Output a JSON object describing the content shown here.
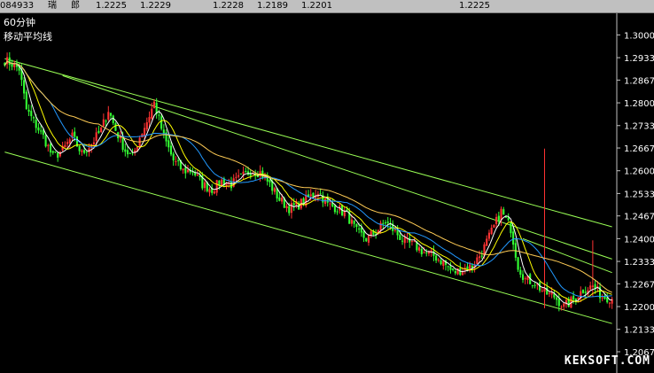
{
  "header": {
    "fields": [
      "084933",
      "瑞",
      "郎",
      "1.2225",
      "1.2229",
      "1.2228",
      "1.2189",
      "1.2201",
      "1.2225"
    ]
  },
  "main_title": "60分钟",
  "subtitle": "移动平均线",
  "watermark": "KEKSOFT.COM",
  "chart_data": {
    "type": "candlestick",
    "title": "60分钟",
    "subtitle": "移动平均线",
    "ylim": [
      1.2067,
      1.3035
    ],
    "y_ticks": [
      "1.3000",
      "1.2933",
      "1.2867",
      "1.2800",
      "1.2733",
      "1.2667",
      "1.2600",
      "1.2533",
      "1.2467",
      "1.2400",
      "1.2333",
      "1.2267",
      "1.2200",
      "1.2133",
      "1.2067"
    ],
    "grid": false,
    "candles_shown": 190,
    "close_path_anchors": [
      [
        0,
        1.2925
      ],
      [
        3,
        1.2915
      ],
      [
        6,
        1.29
      ],
      [
        9,
        1.278
      ],
      [
        12,
        1.2745
      ],
      [
        16,
        1.27
      ],
      [
        20,
        1.264
      ],
      [
        24,
        1.266
      ],
      [
        28,
        1.27
      ],
      [
        32,
        1.265
      ],
      [
        36,
        1.268
      ],
      [
        40,
        1.272
      ],
      [
        43,
        1.278
      ],
      [
        46,
        1.272
      ],
      [
        50,
        1.266
      ],
      [
        53,
        1.264
      ],
      [
        56,
        1.27
      ],
      [
        59,
        1.2745
      ],
      [
        62,
        1.28
      ],
      [
        66,
        1.27
      ],
      [
        70,
        1.263
      ],
      [
        74,
        1.26
      ],
      [
        78,
        1.26
      ],
      [
        82,
        1.256
      ],
      [
        86,
        1.2545
      ],
      [
        90,
        1.257
      ],
      [
        94,
        1.256
      ],
      [
        98,
        1.258
      ],
      [
        102,
        1.26
      ],
      [
        106,
        1.2595
      ],
      [
        110,
        1.256
      ],
      [
        114,
        1.2515
      ],
      [
        118,
        1.249
      ],
      [
        122,
        1.25
      ],
      [
        126,
        1.252
      ],
      [
        130,
        1.254
      ],
      [
        134,
        1.25
      ],
      [
        138,
        1.249
      ],
      [
        142,
        1.247
      ],
      [
        146,
        1.242
      ],
      [
        150,
        1.24
      ],
      [
        154,
        1.242
      ],
      [
        158,
        1.245
      ],
      [
        162,
        1.242
      ],
      [
        166,
        1.239
      ],
      [
        170,
        1.238
      ],
      [
        174,
        1.236
      ],
      [
        178,
        1.235
      ],
      [
        182,
        1.233
      ],
      [
        186,
        1.23
      ],
      [
        190,
        1.231
      ],
      [
        194,
        1.232
      ],
      [
        198,
        1.236
      ],
      [
        202,
        1.242
      ],
      [
        206,
        1.248
      ],
      [
        210,
        1.243
      ],
      [
        213,
        1.232
      ],
      [
        216,
        1.228
      ],
      [
        220,
        1.227
      ],
      [
        224,
        1.224
      ],
      [
        228,
        1.223
      ],
      [
        232,
        1.22
      ],
      [
        236,
        1.222
      ],
      [
        240,
        1.225
      ],
      [
        244,
        1.226
      ],
      [
        248,
        1.223
      ],
      [
        252,
        1.2225
      ]
    ],
    "channel_lines": [
      {
        "name": "upper",
        "color": "#99ff55",
        "points": [
          [
            0,
            1.293
          ],
          [
            252,
            1.2435
          ]
        ]
      },
      {
        "name": "lower",
        "color": "#99ff55",
        "points": [
          [
            0,
            1.2655
          ],
          [
            252,
            1.215
          ]
        ]
      },
      {
        "name": "fan-1",
        "color": "#99ff55",
        "points": [
          [
            24,
            1.288
          ],
          [
            252,
            1.234
          ]
        ]
      },
      {
        "name": "fan-2",
        "color": "#99ff55",
        "points": [
          [
            215,
            1.24
          ],
          [
            252,
            1.23
          ]
        ]
      }
    ],
    "moving_averages": [
      {
        "period": 5,
        "color": "#ffffff"
      },
      {
        "period": 10,
        "color": "#ffff00"
      },
      {
        "period": 20,
        "color": "#2299ff"
      },
      {
        "period": 40,
        "color": "#ffcc55"
      }
    ],
    "candle_colors": {
      "up": "#ff3333",
      "down": "#33ff33"
    },
    "spikes": [
      {
        "index": 224,
        "high": 1.2665,
        "low": 1.2195
      },
      {
        "index": 244,
        "high": 1.2395,
        "low": 1.223
      }
    ]
  }
}
